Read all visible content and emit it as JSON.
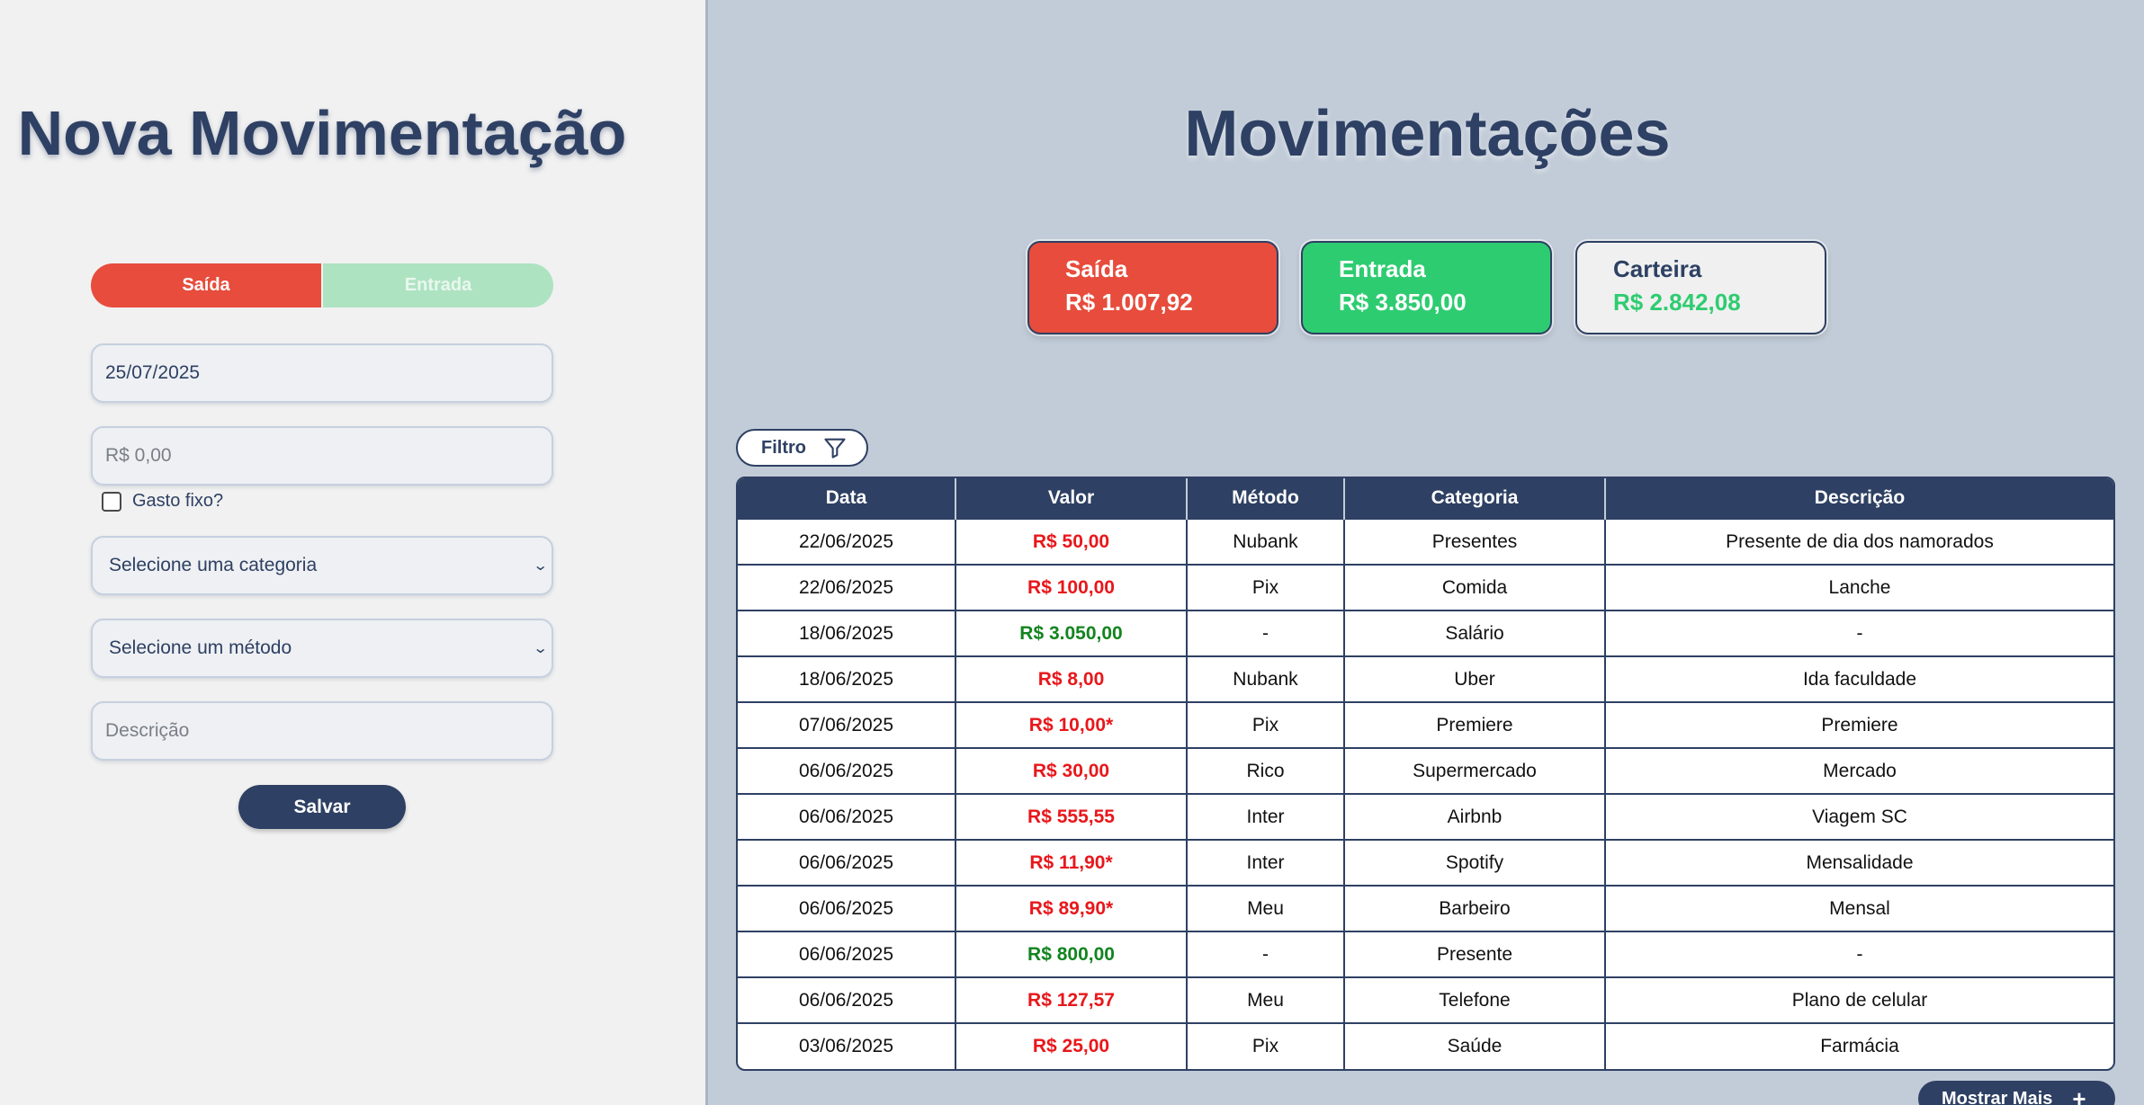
{
  "left": {
    "title": "Nova Movimentação",
    "toggle": {
      "saida_label": "Saída",
      "entrada_label": "Entrada",
      "active": "Saída"
    },
    "date_value": "25/07/2025",
    "amount_placeholder": "R$ 0,00",
    "fixed_expense_label": "Gasto fixo?",
    "category_select": "Selecione uma categoria",
    "method_select": "Selecione um método",
    "description_placeholder": "Descrição",
    "save_label": "Salvar"
  },
  "right": {
    "title": "Movimentações",
    "cards": {
      "saida": {
        "label": "Saída",
        "value": "R$ 1.007,92"
      },
      "entrada": {
        "label": "Entrada",
        "value": "R$ 3.850,00"
      },
      "carteira": {
        "label": "Carteira",
        "value": "R$ 2.842,08"
      }
    },
    "filter_label": "Filtro",
    "table": {
      "headers": [
        "Data",
        "Valor",
        "Método",
        "Categoria",
        "Descrição"
      ],
      "rows": [
        [
          "22/06/2025",
          "R$ 50,00",
          "Nubank",
          "Presentes",
          "Presente de dia dos namorados",
          "out"
        ],
        [
          "22/06/2025",
          "R$ 100,00",
          "Pix",
          "Comida",
          "Lanche",
          "out"
        ],
        [
          "18/06/2025",
          "R$ 3.050,00",
          "-",
          "Salário",
          "-",
          "in"
        ],
        [
          "18/06/2025",
          "R$ 8,00",
          "Nubank",
          "Uber",
          "Ida faculdade",
          "out"
        ],
        [
          "07/06/2025",
          "R$ 10,00*",
          "Pix",
          "Premiere",
          "Premiere",
          "out"
        ],
        [
          "06/06/2025",
          "R$ 30,00",
          "Rico",
          "Supermercado",
          "Mercado",
          "out"
        ],
        [
          "06/06/2025",
          "R$ 555,55",
          "Inter",
          "Airbnb",
          "Viagem SC",
          "out"
        ],
        [
          "06/06/2025",
          "R$ 11,90*",
          "Inter",
          "Spotify",
          "Mensalidade",
          "out"
        ],
        [
          "06/06/2025",
          "R$ 89,90*",
          "Meu",
          "Barbeiro",
          "Mensal",
          "out"
        ],
        [
          "06/06/2025",
          "R$ 800,00",
          "-",
          "Presente",
          "-",
          "in"
        ],
        [
          "06/06/2025",
          "R$ 127,57",
          "Meu",
          "Telefone",
          "Plano de celular",
          "out"
        ],
        [
          "03/06/2025",
          "R$ 25,00",
          "Pix",
          "Saúde",
          "Farmácia",
          "out"
        ]
      ]
    },
    "more_label": "Mostrar Mais",
    "more_icon": "plus-icon",
    "filter_icon": "funnel-icon"
  },
  "colors": {
    "primary": "#2e4063",
    "saida": "#e74c3c",
    "entrada": "#2ecc71",
    "valor_out": "#e8171b",
    "valor_in": "#13841f"
  }
}
